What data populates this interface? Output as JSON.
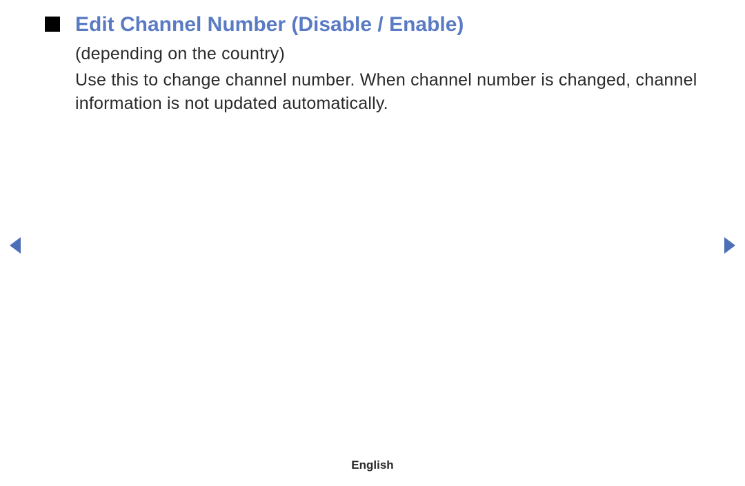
{
  "title": "Edit Channel Number (Disable / Enable)",
  "subtitle": "(depending on the country)",
  "description": "Use this to change channel number. When channel number is changed, channel information is not updated automatically.",
  "footer": {
    "language": "English"
  },
  "nav": {
    "arrow_color": "#4d6fb8"
  }
}
